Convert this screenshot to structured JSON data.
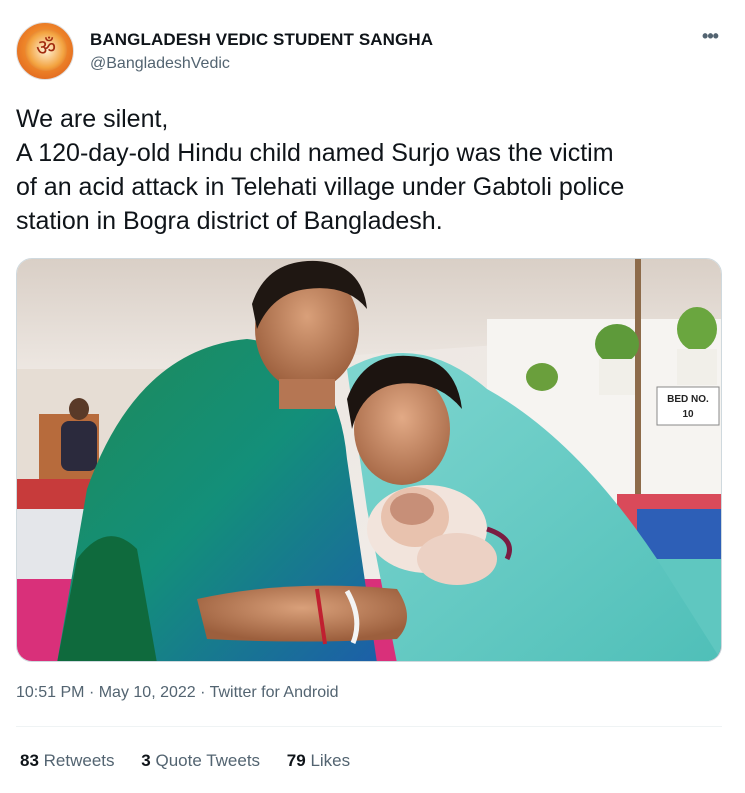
{
  "account": {
    "name": "BANGLADESH VEDIC STUDENT SANGHA",
    "handle": "@BangladeshVedic",
    "avatar_icon": "om-symbol-logo"
  },
  "menu": {
    "more_label": "•••"
  },
  "tweet": {
    "lines": [
      "We are silent,",
      "A 120-day-old Hindu child named Surjo was the victim",
      "of an acid attack in Telehati village under Gabtoli police",
      "station in Bogra district of Bangladesh."
    ]
  },
  "photo": {
    "sign_line1": "BED NO.",
    "sign_line2": "10"
  },
  "meta": {
    "time": "10:51 PM",
    "date": "May 10, 2022",
    "source": "Twitter for Android",
    "sep": "·"
  },
  "stats": {
    "retweets_count": "83",
    "retweets_label": "Retweets",
    "quotes_count": "3",
    "quotes_label": "Quote Tweets",
    "likes_count": "79",
    "likes_label": "Likes"
  },
  "colors": {
    "text": "#0f1419",
    "secondary": "#536471",
    "border": "#cfd9de"
  }
}
